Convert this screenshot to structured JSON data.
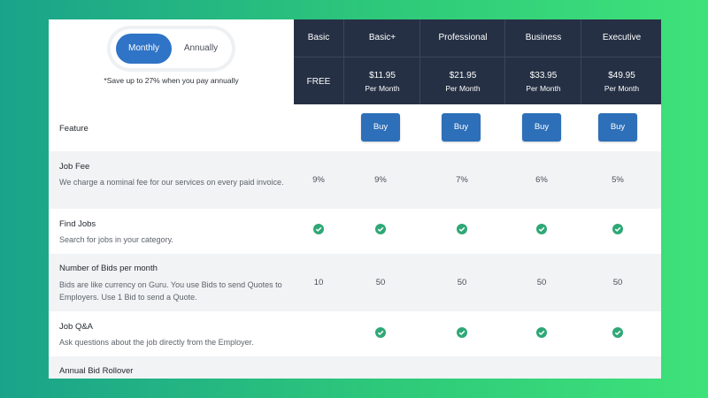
{
  "billing_toggle": {
    "monthly": "Monthly",
    "annually": "Annually",
    "selected": "Monthly"
  },
  "save_note": "*Save up to 27% when you pay annually",
  "plans": [
    {
      "name": "Basic",
      "price": "FREE",
      "period": ""
    },
    {
      "name": "Basic+",
      "price": "$11.95",
      "period": "Per Month"
    },
    {
      "name": "Professional",
      "price": "$21.95",
      "period": "Per Month"
    },
    {
      "name": "Business",
      "price": "$33.95",
      "period": "Per Month"
    },
    {
      "name": "Executive",
      "price": "$49.95",
      "period": "Per Month"
    }
  ],
  "feature_header": "Feature",
  "buy_label": "Buy",
  "features": [
    {
      "title": "Job Fee",
      "desc": "We charge a nominal fee for our services on every paid invoice.",
      "values": [
        "9%",
        "9%",
        "7%",
        "6%",
        "5%"
      ]
    },
    {
      "title": "Find Jobs",
      "desc": "Search for jobs in your category.",
      "values": [
        "check",
        "check",
        "check",
        "check",
        "check"
      ]
    },
    {
      "title": "Number of Bids per month",
      "desc": "Bids are like currency on Guru. You use Bids to send Quotes to Employers. Use 1 Bid to send a Quote.",
      "values": [
        "10",
        "50",
        "50",
        "50",
        "50"
      ]
    },
    {
      "title": "Job Q&A",
      "desc": "Ask questions about the job directly from the Employer.",
      "values": [
        "",
        "check",
        "check",
        "check",
        "check"
      ]
    },
    {
      "title": "Annual Bid Rollover",
      "desc": "",
      "values": []
    }
  ],
  "colors": {
    "accent": "#2f74c6",
    "header_bg": "#253044",
    "check": "#2ea876",
    "buy": "#2d6fb8"
  }
}
